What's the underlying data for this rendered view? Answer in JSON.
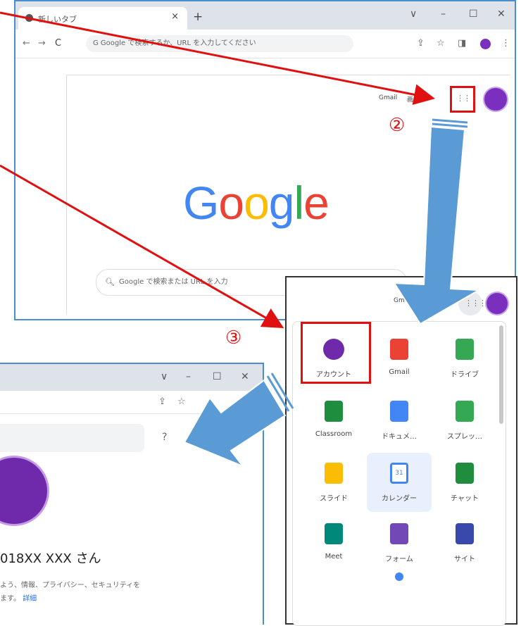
{
  "window1": {
    "tab_title": "新しいタブ",
    "tab_close": "×",
    "new_tab": "+",
    "window_controls": [
      "∨",
      "–",
      "☐",
      "✕"
    ],
    "nav": [
      "←",
      "→",
      "C"
    ],
    "omnibox": "G Google で検索するか、URL を入力してください",
    "toolbar_icons": [
      "share-icon",
      "star-icon",
      "sidepanel-icon"
    ],
    "gmail": "Gmail",
    "images": "画像",
    "logo": "Google",
    "logo_colors": [
      "#4285F4",
      "#EA4335",
      "#FBBC05",
      "#4285F4",
      "#34A853",
      "#EA4335"
    ],
    "search_placeholder": "Google で検索または URL を入力"
  },
  "step2": "②",
  "step3": "③",
  "popup": {
    "gmail": "Gmail",
    "apps": [
      {
        "label": "アカウント",
        "icon": "account-icon",
        "color": "#6e2aab"
      },
      {
        "label": "Gmail",
        "icon": "gmail-icon",
        "color": "#EA4335"
      },
      {
        "label": "ドライブ",
        "icon": "drive-icon",
        "color": "#34A853"
      },
      {
        "label": "Classroom",
        "icon": "classroom-icon",
        "color": "#1e8e3e"
      },
      {
        "label": "ドキュメ…",
        "icon": "docs-icon",
        "color": "#4285F4"
      },
      {
        "label": "スプレッ…",
        "icon": "sheets-icon",
        "color": "#34A853"
      },
      {
        "label": "スライド",
        "icon": "slides-icon",
        "color": "#FBBC05"
      },
      {
        "label": "カレンダー",
        "icon": "calendar-icon",
        "color": "#4285F4"
      },
      {
        "label": "チャット",
        "icon": "chat-icon",
        "color": "#1e8e3e"
      },
      {
        "label": "Meet",
        "icon": "meet-icon",
        "color": "#00897b"
      },
      {
        "label": "フォーム",
        "icon": "forms-icon",
        "color": "#7248b9"
      },
      {
        "label": "サイト",
        "icon": "sites-icon",
        "color": "#3949ab"
      }
    ],
    "calendar_day": "31"
  },
  "window2": {
    "window_controls": [
      "∨",
      "–",
      "☐",
      "✕"
    ],
    "help": "?",
    "user_name": "018XX XXX さん",
    "desc_line1": "よう、情報、プライバシー、セキュリティを",
    "desc_line2": "ます。",
    "more_link": "詳細",
    "arrow_color": "#5b9bd5",
    "highlight_color": "#e01010"
  }
}
